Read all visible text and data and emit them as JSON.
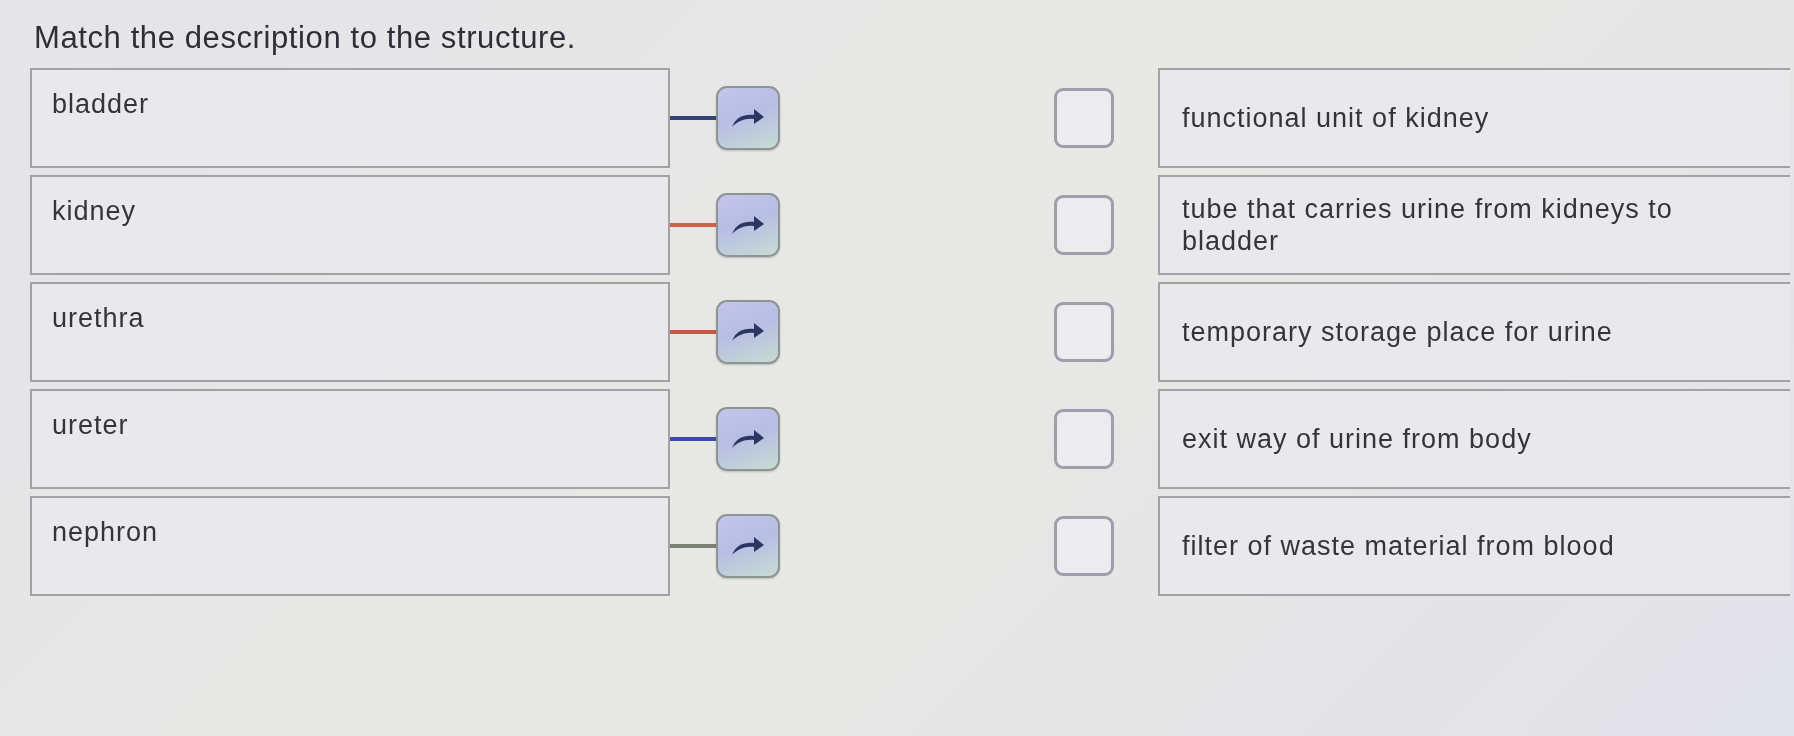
{
  "title": "Match the description to the structure.",
  "terms": [
    {
      "label": "bladder",
      "color": "#34427a"
    },
    {
      "label": "kidney",
      "color": "#d2604c"
    },
    {
      "label": "urethra",
      "color": "#c9574a"
    },
    {
      "label": "ureter",
      "color": "#3c4aa8"
    },
    {
      "label": "nephron",
      "color": "#7c8272"
    }
  ],
  "descriptions": [
    {
      "text": "functional unit of kidney"
    },
    {
      "text": "tube that carries urine from kidneys to bladder"
    },
    {
      "text": "temporary storage place for urine"
    },
    {
      "text": "exit way of urine from body"
    },
    {
      "text": "filter of waste material from blood"
    }
  ]
}
